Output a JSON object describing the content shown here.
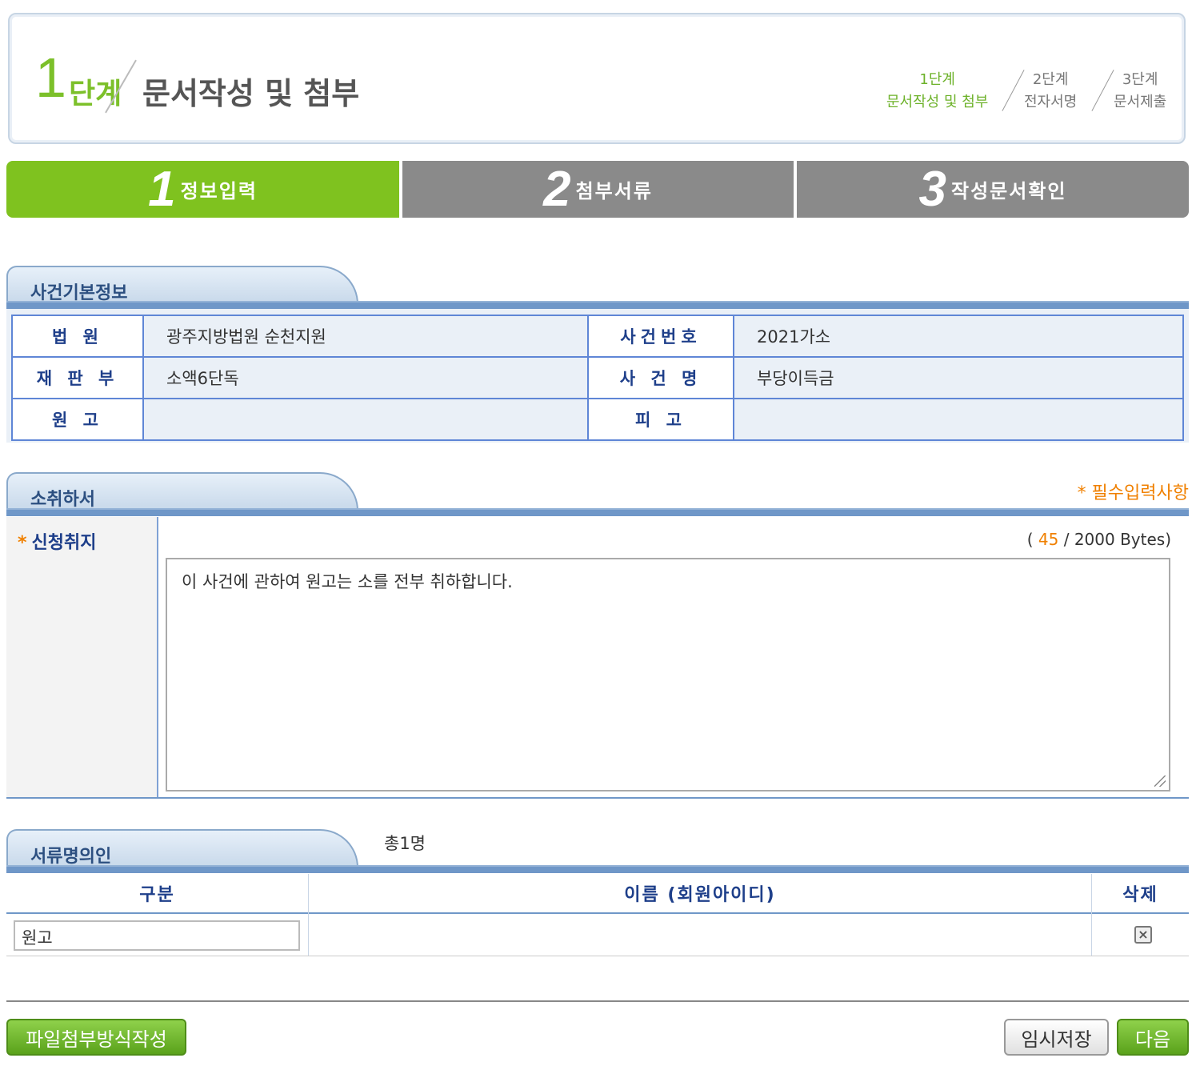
{
  "header": {
    "stage_number": "1",
    "stage_word": "단계",
    "stage_title": "문서작성 및 첨부",
    "steps": [
      {
        "line1": "1단계",
        "line2": "문서작성 및 첨부"
      },
      {
        "line1": "2단계",
        "line2": "전자서명"
      },
      {
        "line1": "3단계",
        "line2": "문서제출"
      }
    ]
  },
  "tabs": [
    {
      "num": "1",
      "label": "정보입력"
    },
    {
      "num": "2",
      "label": "첨부서류"
    },
    {
      "num": "3",
      "label": "작성문서확인"
    }
  ],
  "case_info": {
    "title": "사건기본정보",
    "rows": [
      {
        "label1": "법 원",
        "value1": "광주지방법원 순천지원",
        "label2": "사건번호",
        "value2": "2021가소"
      },
      {
        "label1": "재 판 부",
        "value1": "소액6단독",
        "label2": "사 건 명",
        "value2": "부당이득금"
      },
      {
        "label1": "원 고",
        "value1": "",
        "label2": "피 고",
        "value2": ""
      }
    ]
  },
  "withdrawal": {
    "title": "소취하서",
    "required_note": "* 필수입력사항",
    "field_label": "신청취지",
    "required_star": "*",
    "bytes_open": "(",
    "bytes_count": "45",
    "bytes_rest": "/ 2000 Bytes)",
    "text": "이 사건에 관하여 원고는 소를 전부 취하합니다."
  },
  "signers": {
    "title": "서류명의인",
    "total": "총1명",
    "columns": [
      "구분",
      "이름 (회원아이디)",
      "삭제"
    ],
    "rows": [
      {
        "type": "원고",
        "name": ""
      }
    ]
  },
  "buttons": {
    "file_attach": "파일첨부방식작성",
    "temp_save": "임시저장",
    "next": "다음"
  }
}
